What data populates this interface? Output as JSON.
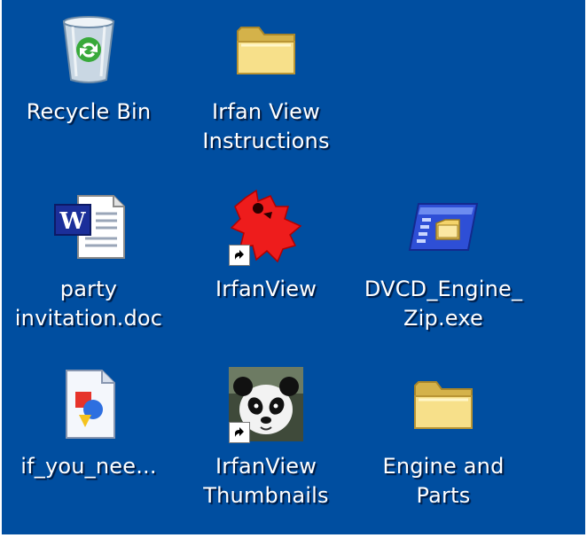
{
  "desktop": {
    "icons": [
      {
        "id": "recycle-bin",
        "lines": [
          "Recycle Bin"
        ],
        "icon": "recycle-bin-icon"
      },
      {
        "id": "irfan-view-instructions",
        "lines": [
          "Irfan View",
          "Instructions"
        ],
        "icon": "folder-icon"
      },
      {
        "id": "party-invitation",
        "lines": [
          "party",
          "invitation.doc"
        ],
        "icon": "word-document-icon"
      },
      {
        "id": "irfanview",
        "lines": [
          "IrfanView"
        ],
        "icon": "irfanview-icon",
        "shortcut": true
      },
      {
        "id": "dvcd-engine-zip",
        "lines": [
          "DVCD_Engine_",
          "Zip.exe"
        ],
        "icon": "installer-exe-icon"
      },
      {
        "id": "if-you-nee",
        "lines": [
          "if_you_nee..."
        ],
        "icon": "generic-document-icon"
      },
      {
        "id": "irfanview-thumbnails",
        "lines": [
          "IrfanView",
          "Thumbnails"
        ],
        "icon": "panda-thumbnail-icon",
        "shortcut": true
      },
      {
        "id": "engine-and-parts",
        "lines": [
          "Engine and",
          "Parts"
        ],
        "icon": "folder-icon"
      }
    ],
    "colors": {
      "background": "#004ea0",
      "label": "#ffffff"
    }
  }
}
